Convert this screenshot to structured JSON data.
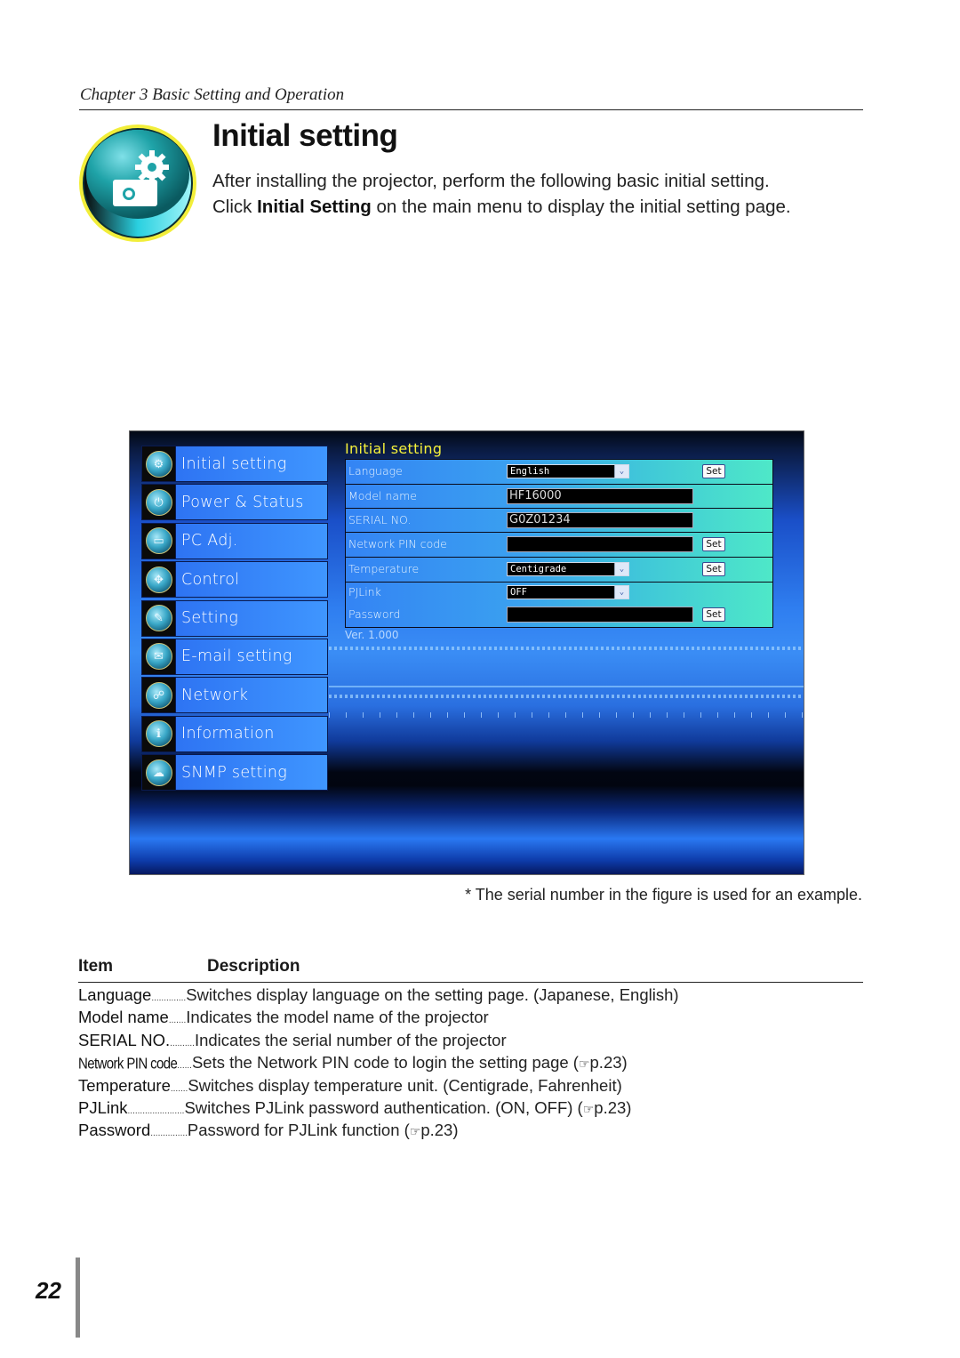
{
  "chapter": {
    "title": "Chapter 3 Basic Setting and Operation"
  },
  "section": {
    "icon": "settings-camera-icon",
    "title": "Initial setting",
    "intro_line1": "After installing the projector, perform the following basic initial setting.",
    "intro_line2_pre": "Click ",
    "intro_line2_bold": "Initial Setting",
    "intro_line2_post": " on the main menu to display the initial setting page."
  },
  "figure": {
    "nav_items": [
      {
        "label": "Initial setting",
        "icon": "⚙"
      },
      {
        "label": "Power & Status",
        "icon": "⏻"
      },
      {
        "label": "PC Adj.",
        "icon": "▭"
      },
      {
        "label": "Control",
        "icon": "✥"
      },
      {
        "label": "Setting",
        "icon": "✎"
      },
      {
        "label": "E-mail setting",
        "icon": "✉"
      },
      {
        "label": "Network",
        "icon": "☍"
      },
      {
        "label": "Information",
        "icon": "ℹ"
      },
      {
        "label": "SNMP setting",
        "icon": "☁"
      }
    ],
    "panel_title": "Initial setting",
    "rows": {
      "language": {
        "label": "Language",
        "value": "English",
        "set": "Set"
      },
      "model_name": {
        "label": "Model name",
        "value": "HF16000"
      },
      "serial_no": {
        "label": "SERIAL NO.",
        "value": "G0Z01234"
      },
      "network_pin": {
        "label": "Network PIN code",
        "value": "",
        "set": "Set"
      },
      "temperature": {
        "label": "Temperature",
        "value": "Centigrade",
        "set": "Set"
      },
      "pjlink": {
        "label": "PJLink",
        "value": "OFF"
      },
      "password": {
        "label": "Password",
        "value": "",
        "set": "Set"
      }
    },
    "dropdown_arrow": "⌄",
    "version": "Ver. 1.000"
  },
  "footnote": "* The serial number in the figure is used for an example.",
  "description_table": {
    "header_item": "Item",
    "header_description": "Description",
    "rows": [
      {
        "term": "Language",
        "dots": "..............",
        "text": "Switches display language on the setting page. (Japanese, English)",
        "ref": ""
      },
      {
        "term": "Model name",
        "dots": " .......",
        "text": "Indicates the model name of the projector",
        "ref": ""
      },
      {
        "term": "SERIAL NO.",
        "dots": " ..........",
        "text": "Indicates the serial number of the projector",
        "ref": ""
      },
      {
        "term": "Network PIN code",
        "dots": " ......",
        "text": "Sets the Network PIN code to login the setting page (",
        "ref": "p.23)"
      },
      {
        "term": "Temperature",
        "dots": ".......",
        "text": "Switches display temperature unit. (Centigrade, Fahrenheit)",
        "ref": ""
      },
      {
        "term": "PJLink",
        "dots": ".......................",
        "text": "Switches PJLink password authentication. (ON, OFF) (",
        "ref": "p.23)"
      },
      {
        "term": "Password",
        "dots": "...............",
        "text": "Password for PJLink function (",
        "ref": "p.23)"
      }
    ],
    "ref_icon": "☞"
  },
  "page_number": "22"
}
